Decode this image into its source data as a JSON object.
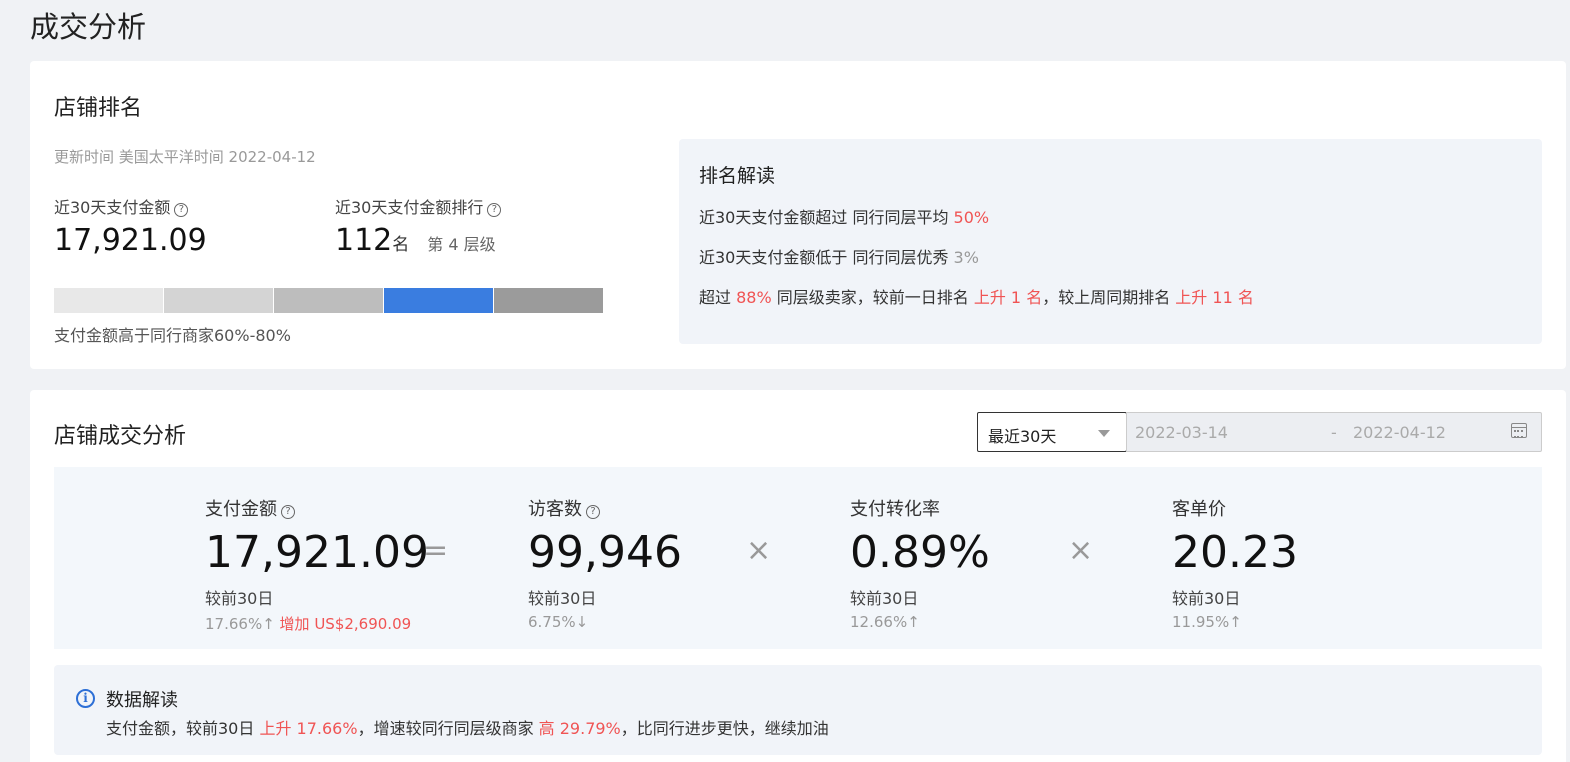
{
  "page": {
    "title": "成交分析"
  },
  "store_rank": {
    "title": "店铺排名",
    "update_time": "更新时间 美国太平洋时间 2022-04-12",
    "amount_label": "近30天支付金额",
    "amount_value": "17,921.09",
    "rank_label": "近30天支付金额排行",
    "rank_value": "112",
    "rank_unit": "名",
    "rank_tier": "第 4 层级",
    "tier_colors": [
      "#e8e8e8",
      "#d4d4d4",
      "#bdbdbd",
      "#3a7de0",
      "#9b9b9b"
    ],
    "active_tier": 4,
    "tier_note": "支付金额高于同行商家60%-80%",
    "interp": {
      "title": "排名解读",
      "line1_prefix": "近30天支付金额超过 同行同层平均 ",
      "line1_value": "50%",
      "line2_prefix": "近30天支付金额低于 同行同层优秀 ",
      "line2_value": "3%",
      "line3_a": "超过 ",
      "line3_b": "88%",
      "line3_c": " 同层级卖家，较前一日排名 ",
      "line3_d": "上升 1 名",
      "line3_e": "，较上周同期排名 ",
      "line3_f": "上升 11 名"
    }
  },
  "deal_analysis": {
    "title": "店铺成交分析",
    "range_select": "最近30天",
    "date_start": "2022-03-14",
    "date_sep": "-",
    "date_end": "2022-04-12",
    "operators": {
      "eq": "=",
      "times1": "×",
      "times2": "×"
    },
    "metrics": {
      "pay_amount": {
        "label": "支付金额",
        "value": "17,921.09",
        "compare": "较前30日",
        "change": "17.66%↑",
        "extra": "增加 US$2,690.09"
      },
      "visitors": {
        "label": "访客数",
        "value": "99,946",
        "compare": "较前30日",
        "change": "6.75%↓"
      },
      "conversion": {
        "label": "支付转化率",
        "value": "0.89%",
        "compare": "较前30日",
        "change": "12.66%↑"
      },
      "unit_price": {
        "label": "客单价",
        "value": "20.23",
        "compare": "较前30日",
        "change": "11.95%↑"
      }
    },
    "interp": {
      "title": "数据解读",
      "text_a": "支付金额，较前30日 ",
      "text_b": "上升 17.66%",
      "text_c": "，增速较同行同层级商家 ",
      "text_d": "高 29.79%",
      "text_e": "，比同行进步更快，继续加油"
    }
  }
}
